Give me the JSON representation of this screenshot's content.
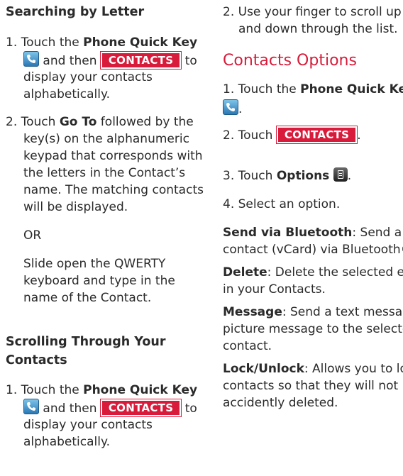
{
  "left": {
    "h_search": "Searching by Letter",
    "s1": {
      "pre": "1. Touch the ",
      "bold": "Phone Quick Key",
      "and_then": "and then",
      "to": "to",
      "l3": "display your contacts",
      "l4": "alphabetically."
    },
    "s2": {
      "pre": "2. Touch ",
      "bold": "Go To",
      "post": " followed by the",
      "l2": "key(s) on the alphanumeric",
      "l3": "keypad that corresponds with",
      "l4": "the letters in the Contact’s",
      "l5": "name. The matching contacts",
      "l6": "will be displayed."
    },
    "or": "OR",
    "slide": {
      "l1": "Slide open the QWERTY",
      "l2": "keyboard and type in the",
      "l3": "name of the Contact."
    },
    "h_scroll_1": "Scrolling Through Your",
    "h_scroll_2": "Contacts",
    "s3": {
      "pre": "1. Touch the ",
      "bold": "Phone Quick Key",
      "and_then": "and then",
      "to": "to",
      "l3": "display your contacts",
      "l4": "alphabetically."
    }
  },
  "right": {
    "s4": {
      "l1": "2. Use your finger to scroll up",
      "l2": "and down through the list."
    },
    "h_options": "Contacts Options",
    "o1": {
      "pre": "1. Touch the ",
      "bold": "Phone Quick Key"
    },
    "o2": {
      "pre": "2. Touch "
    },
    "o3": {
      "pre": "3. Touch ",
      "bold": "Options"
    },
    "o4": "4. Select an option.",
    "send": {
      "bold": "Send via Bluetooth",
      "post": ": Send a",
      "l2": "contact (vCard) via Bluetooth®."
    },
    "del": {
      "bold": "Delete",
      "post": ": Delete the selected entry",
      "l2": "in your Contacts."
    },
    "msg": {
      "bold": "Message",
      "post": ": Send a text message or",
      "l2": "picture message to the selected",
      "l3": "contact."
    },
    "lock": {
      "bold": "Lock/Unlock",
      "post": ": Allows you to lock",
      "l2": "contacts so that they will not be",
      "l3": "accidently deleted."
    }
  },
  "softkey_label": "CONTACTS",
  "icons": {
    "phone_key": "phone-quick-key-icon",
    "options_key": "options-key-icon"
  },
  "colors": {
    "accent": "#d81b3a",
    "text": "#2a2a2a",
    "phone_key": "#3b8cc8"
  }
}
